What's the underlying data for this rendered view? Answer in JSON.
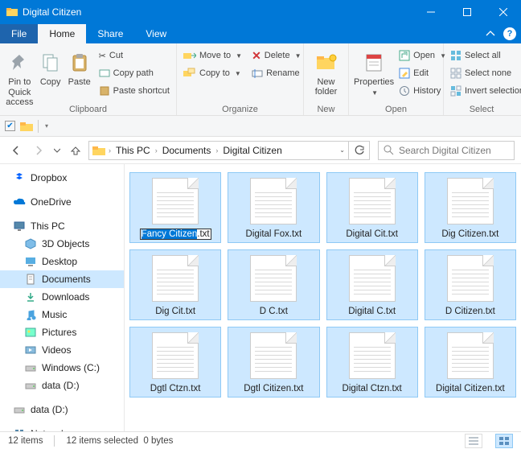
{
  "window": {
    "title": "Digital Citizen"
  },
  "tabs": {
    "file": "File",
    "home": "Home",
    "share": "Share",
    "view": "View"
  },
  "ribbon": {
    "clipboard": {
      "label": "Clipboard",
      "pin": "Pin to Quick access",
      "copy": "Copy",
      "paste": "Paste",
      "cut": "Cut",
      "copypath": "Copy path",
      "pasteshortcut": "Paste shortcut"
    },
    "organize": {
      "label": "Organize",
      "moveto": "Move to",
      "copyto": "Copy to",
      "delete": "Delete",
      "rename": "Rename"
    },
    "new_": {
      "label": "New",
      "newfolder": "New folder"
    },
    "open": {
      "label": "Open",
      "properties": "Properties",
      "open": "Open",
      "edit": "Edit",
      "history": "History"
    },
    "select": {
      "label": "Select",
      "all": "Select all",
      "none": "Select none",
      "invert": "Invert selection"
    }
  },
  "breadcrumb": {
    "a": "This PC",
    "b": "Documents",
    "c": "Digital Citizen"
  },
  "search": {
    "placeholder": "Search Digital Citizen"
  },
  "tree": {
    "dropbox": "Dropbox",
    "onedrive": "OneDrive",
    "thispc": "This PC",
    "objects3d": "3D Objects",
    "desktop": "Desktop",
    "documents": "Documents",
    "downloads": "Downloads",
    "music": "Music",
    "pictures": "Pictures",
    "videos": "Videos",
    "cdrive": "Windows (C:)",
    "ddrive": "data (D:)",
    "ddrive2": "data (D:)",
    "network": "Network"
  },
  "rename": {
    "basename": "Fancy Citizen",
    "ext": ".txt"
  },
  "files": [
    "Fancy Citizen.txt",
    "Digital Fox.txt",
    "Digital Cit.txt",
    "Dig Citizen.txt",
    "Dig Cit.txt",
    "D C.txt",
    "Digital C.txt",
    "D Citizen.txt",
    "Dgtl Ctzn.txt",
    "Dgtl Citizen.txt",
    "Digital Ctzn.txt",
    "Digital Citizen.txt"
  ],
  "status": {
    "count": "12 items",
    "selection": "12 items selected",
    "size": "0 bytes"
  }
}
